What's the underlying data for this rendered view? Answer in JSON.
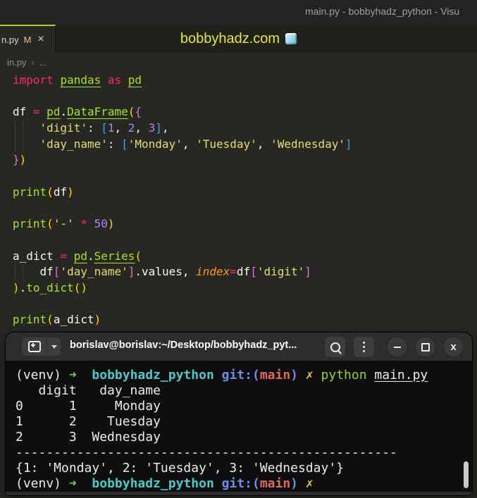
{
  "window": {
    "titlebar_text": "main.py - bobbyhadz_python - Visu"
  },
  "editor": {
    "tab": {
      "label": "n.py",
      "modified_badge": "M",
      "close_glyph": "×"
    },
    "watermark": {
      "text": "bobbyhadz.com",
      "icon": "ice-cube"
    },
    "breadcrumb": {
      "file": "in.py",
      "chevron": "›",
      "more": "..."
    },
    "colors": {
      "background": "#272822",
      "keyword": "#f92672",
      "function": "#a6e22e",
      "string": "#e6db74",
      "number": "#ae81ff",
      "foreground": "#f8f8f2",
      "param": "#fd971f",
      "bracket1": "#ffd702",
      "bracket2": "#da70d6",
      "bracket3": "#3ba3ff",
      "active_tab_border": "#bcd000",
      "watermark": "#e8e73a"
    },
    "code_lines": [
      {
        "g": 0,
        "t": [
          [
            "kw",
            "import "
          ],
          [
            "fnu",
            "pandas"
          ],
          [
            "kw",
            " as "
          ],
          [
            "fnu",
            "pd"
          ]
        ]
      },
      {
        "g": 0,
        "t": []
      },
      {
        "g": 0,
        "t": [
          [
            "txt",
            "df "
          ],
          [
            "kw",
            "= "
          ],
          [
            "fnu",
            "pd"
          ],
          [
            "txt",
            "."
          ],
          [
            "fnu",
            "DataFrame"
          ],
          [
            "b1",
            "("
          ],
          [
            "b2",
            "{"
          ]
        ]
      },
      {
        "g": 1,
        "t": [
          [
            "txt",
            "    "
          ],
          [
            "str",
            "'digit'"
          ],
          [
            "txt",
            ": "
          ],
          [
            "b3",
            "["
          ],
          [
            "num",
            "1"
          ],
          [
            "txt",
            ", "
          ],
          [
            "num",
            "2"
          ],
          [
            "txt",
            ", "
          ],
          [
            "num",
            "3"
          ],
          [
            "b3",
            "]"
          ],
          [
            "txt",
            ","
          ]
        ]
      },
      {
        "g": 1,
        "t": [
          [
            "txt",
            "    "
          ],
          [
            "str",
            "'day_name'"
          ],
          [
            "txt",
            ": "
          ],
          [
            "b3",
            "["
          ],
          [
            "str",
            "'Monday'"
          ],
          [
            "txt",
            ", "
          ],
          [
            "str",
            "'Tuesday'"
          ],
          [
            "txt",
            ", "
          ],
          [
            "str",
            "'Wednesday'"
          ],
          [
            "b3",
            "]"
          ]
        ]
      },
      {
        "g": 0,
        "t": [
          [
            "b2",
            "}"
          ],
          [
            "b1",
            ")"
          ]
        ]
      },
      {
        "g": 0,
        "t": []
      },
      {
        "g": 0,
        "t": [
          [
            "fn",
            "print"
          ],
          [
            "b1",
            "("
          ],
          [
            "txt",
            "df"
          ],
          [
            "b1",
            ")"
          ]
        ]
      },
      {
        "g": 0,
        "t": []
      },
      {
        "g": 0,
        "t": [
          [
            "fn",
            "print"
          ],
          [
            "b1",
            "("
          ],
          [
            "str",
            "'-'"
          ],
          [
            "txt",
            " "
          ],
          [
            "op",
            "*"
          ],
          [
            "txt",
            " "
          ],
          [
            "num",
            "50"
          ],
          [
            "b1",
            ")"
          ]
        ]
      },
      {
        "g": 0,
        "t": []
      },
      {
        "g": 0,
        "t": [
          [
            "txt",
            "a_dict "
          ],
          [
            "kw",
            "= "
          ],
          [
            "fnu",
            "pd"
          ],
          [
            "txt",
            "."
          ],
          [
            "fnu",
            "Series"
          ],
          [
            "b1",
            "("
          ]
        ]
      },
      {
        "g": 1,
        "t": [
          [
            "txt",
            "    df"
          ],
          [
            "b2",
            "["
          ],
          [
            "str",
            "'day_name'"
          ],
          [
            "b2",
            "]"
          ],
          [
            "txt",
            ".values, "
          ],
          [
            "param",
            "index"
          ],
          [
            "op",
            "="
          ],
          [
            "txt",
            "df"
          ],
          [
            "b2",
            "["
          ],
          [
            "str",
            "'digit'"
          ],
          [
            "b2",
            "]"
          ]
        ]
      },
      {
        "g": 0,
        "t": [
          [
            "b1",
            ")"
          ],
          [
            "txt",
            "."
          ],
          [
            "fn",
            "to_dict"
          ],
          [
            "b1",
            "("
          ],
          [
            "b1",
            ")"
          ]
        ]
      },
      {
        "g": 0,
        "t": []
      },
      {
        "g": 0,
        "t": [
          [
            "fn",
            "print"
          ],
          [
            "b1",
            "("
          ],
          [
            "txt",
            "a_dict"
          ],
          [
            "b1",
            ")"
          ]
        ]
      }
    ]
  },
  "terminal": {
    "title": "borislav@borislav:~/Desktop/bobbyhadz_pyt...",
    "icons": {
      "new_tab": "terminal-plus",
      "dropdown": "chevron-down",
      "search": "magnifier",
      "menu": "kebab-vertical",
      "minimize": "minus",
      "maximize": "square-outline",
      "close_glyph": "x"
    },
    "colors": {
      "header": "#2d2d2d",
      "background": "#0e0e0e",
      "prompt_arrow": "#78d32c",
      "dir": "#4ec9c9",
      "git": "#6b8ee6",
      "branch": "#e0695e",
      "dirty": "#ddc24d",
      "command": "#93d13a",
      "text": "#ececec"
    },
    "lines": [
      {
        "t": [
          [
            "w",
            "(venv) "
          ],
          [
            "ar",
            "➜"
          ],
          [
            "w",
            "  "
          ],
          [
            "cy",
            "bobbyhadz_python "
          ],
          [
            "bl",
            "git:("
          ],
          [
            "rd",
            "main"
          ],
          [
            "bl",
            ") "
          ],
          [
            "yl",
            "✗ "
          ],
          [
            "gr",
            "python "
          ],
          [
            "wu",
            "main.py"
          ]
        ]
      },
      {
        "t": [
          [
            "w",
            "   digit   day_name"
          ]
        ]
      },
      {
        "t": [
          [
            "w",
            "0      1     Monday"
          ]
        ]
      },
      {
        "t": [
          [
            "w",
            "1      2    Tuesday"
          ]
        ]
      },
      {
        "t": [
          [
            "w",
            "2      3  Wednesday"
          ]
        ]
      },
      {
        "t": [
          [
            "w",
            "--------------------------------------------------"
          ]
        ]
      },
      {
        "t": [
          [
            "w",
            "{1: 'Monday', 2: 'Tuesday', 3: 'Wednesday'}"
          ]
        ]
      },
      {
        "t": [
          [
            "w",
            "(venv) "
          ],
          [
            "ar",
            "➜"
          ],
          [
            "w",
            "  "
          ],
          [
            "cy",
            "bobbyhadz_python "
          ],
          [
            "bl",
            "git:("
          ],
          [
            "rd",
            "main"
          ],
          [
            "bl",
            ") "
          ],
          [
            "yl",
            "✗"
          ]
        ]
      }
    ]
  }
}
